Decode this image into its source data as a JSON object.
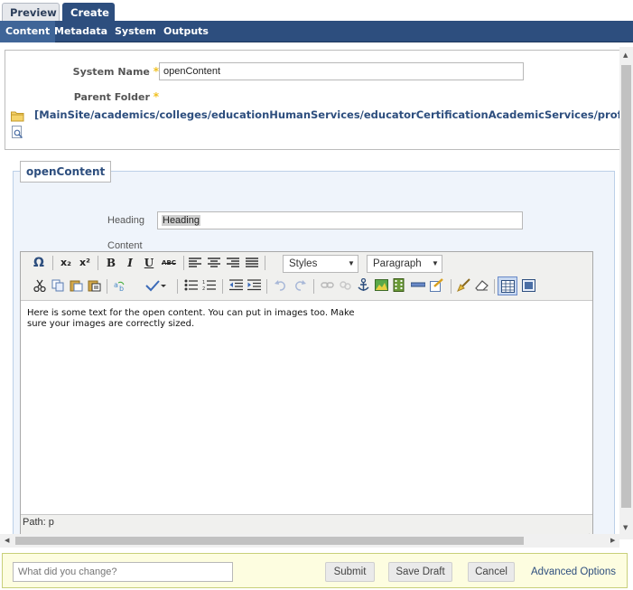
{
  "tabs": {
    "preview": "Preview",
    "create": "Create"
  },
  "subnav": [
    "Content",
    "Metadata",
    "System",
    "Outputs"
  ],
  "system": {
    "name_label": "System Name",
    "name_value": "openContent",
    "parent_label": "Parent Folder",
    "parent_path": "[MainSite/academics/colleges/educationHumanServices/educatorCertificationAcademicServices/professionalD"
  },
  "block": {
    "legend": "openContent",
    "heading_label": "Heading",
    "heading_value": "Heading",
    "content_label": "Content"
  },
  "editor": {
    "styles_label": "Styles",
    "format_label": "Paragraph",
    "body_line1": "Here is some text for the open content. You can put in images too. Make",
    "body_line2": "sure your images are correctly sized.",
    "path": "Path: p",
    "toolbar": {
      "special_char": "Ω",
      "subscript": "x₂",
      "superscript": "x²",
      "bold": "B",
      "italic": "I",
      "underline": "U",
      "strike": "ABC"
    }
  },
  "footer": {
    "change_placeholder": "What did you change?",
    "submit": "Submit",
    "save_draft": "Save Draft",
    "cancel": "Cancel",
    "advanced": "Advanced Options"
  },
  "colors": {
    "nav": "#2d4e7e",
    "accent": "#f0c020",
    "fieldset_bg": "#eff4fb",
    "footer_bg": "#fdfde0"
  }
}
